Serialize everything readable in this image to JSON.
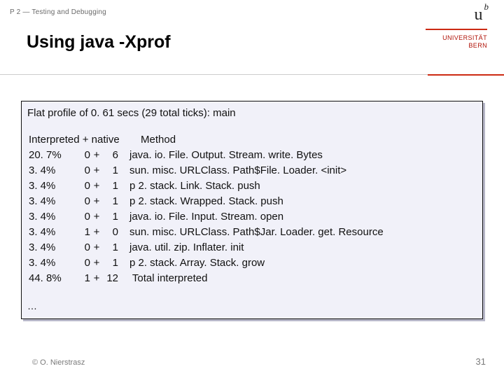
{
  "header_small": "P 2 — Testing and Debugging",
  "title": "Using java -Xprof",
  "logo": {
    "u": "u",
    "b": "b",
    "line1": "UNIVERSITÄT",
    "line2": "BERN"
  },
  "panel_title": "Flat profile of 0. 61 secs (29 total ticks): main",
  "profile": {
    "header_left": "Interpreted + native",
    "header_right": "Method",
    "rows": [
      {
        "pct": "20. 7%",
        "left": "0",
        "plus": "+",
        "right": "6",
        "method": "java. io. File. Output. Stream. write. Bytes"
      },
      {
        "pct": "3. 4%",
        "left": "0",
        "plus": "+",
        "right": "1",
        "method": "sun. misc. URLClass. Path$File. Loader. <init>"
      },
      {
        "pct": "3. 4%",
        "left": "0",
        "plus": "+",
        "right": "1",
        "method": "p 2. stack. Link. Stack. push"
      },
      {
        "pct": "3. 4%",
        "left": "0",
        "plus": "+",
        "right": "1",
        "method": "p 2. stack. Wrapped. Stack. push"
      },
      {
        "pct": "3. 4%",
        "left": "0",
        "plus": "+",
        "right": "1",
        "method": "java. io. File. Input. Stream. open"
      },
      {
        "pct": "3. 4%",
        "left": "1",
        "plus": "+",
        "right": "0",
        "method": "sun. misc. URLClass. Path$Jar. Loader. get. Resource"
      },
      {
        "pct": "3. 4%",
        "left": "0",
        "plus": "+",
        "right": "1",
        "method": "java. util. zip. Inflater. init"
      },
      {
        "pct": "3. 4%",
        "left": "0",
        "plus": "+",
        "right": "1",
        "method": "p 2. stack. Array. Stack. grow"
      },
      {
        "pct": "44. 8%",
        "left": "1",
        "plus": "+",
        "right": "12",
        "method": " Total interpreted"
      }
    ]
  },
  "ellipsis": "…",
  "footer_left": "© O. Nierstrasz",
  "footer_right": "31"
}
